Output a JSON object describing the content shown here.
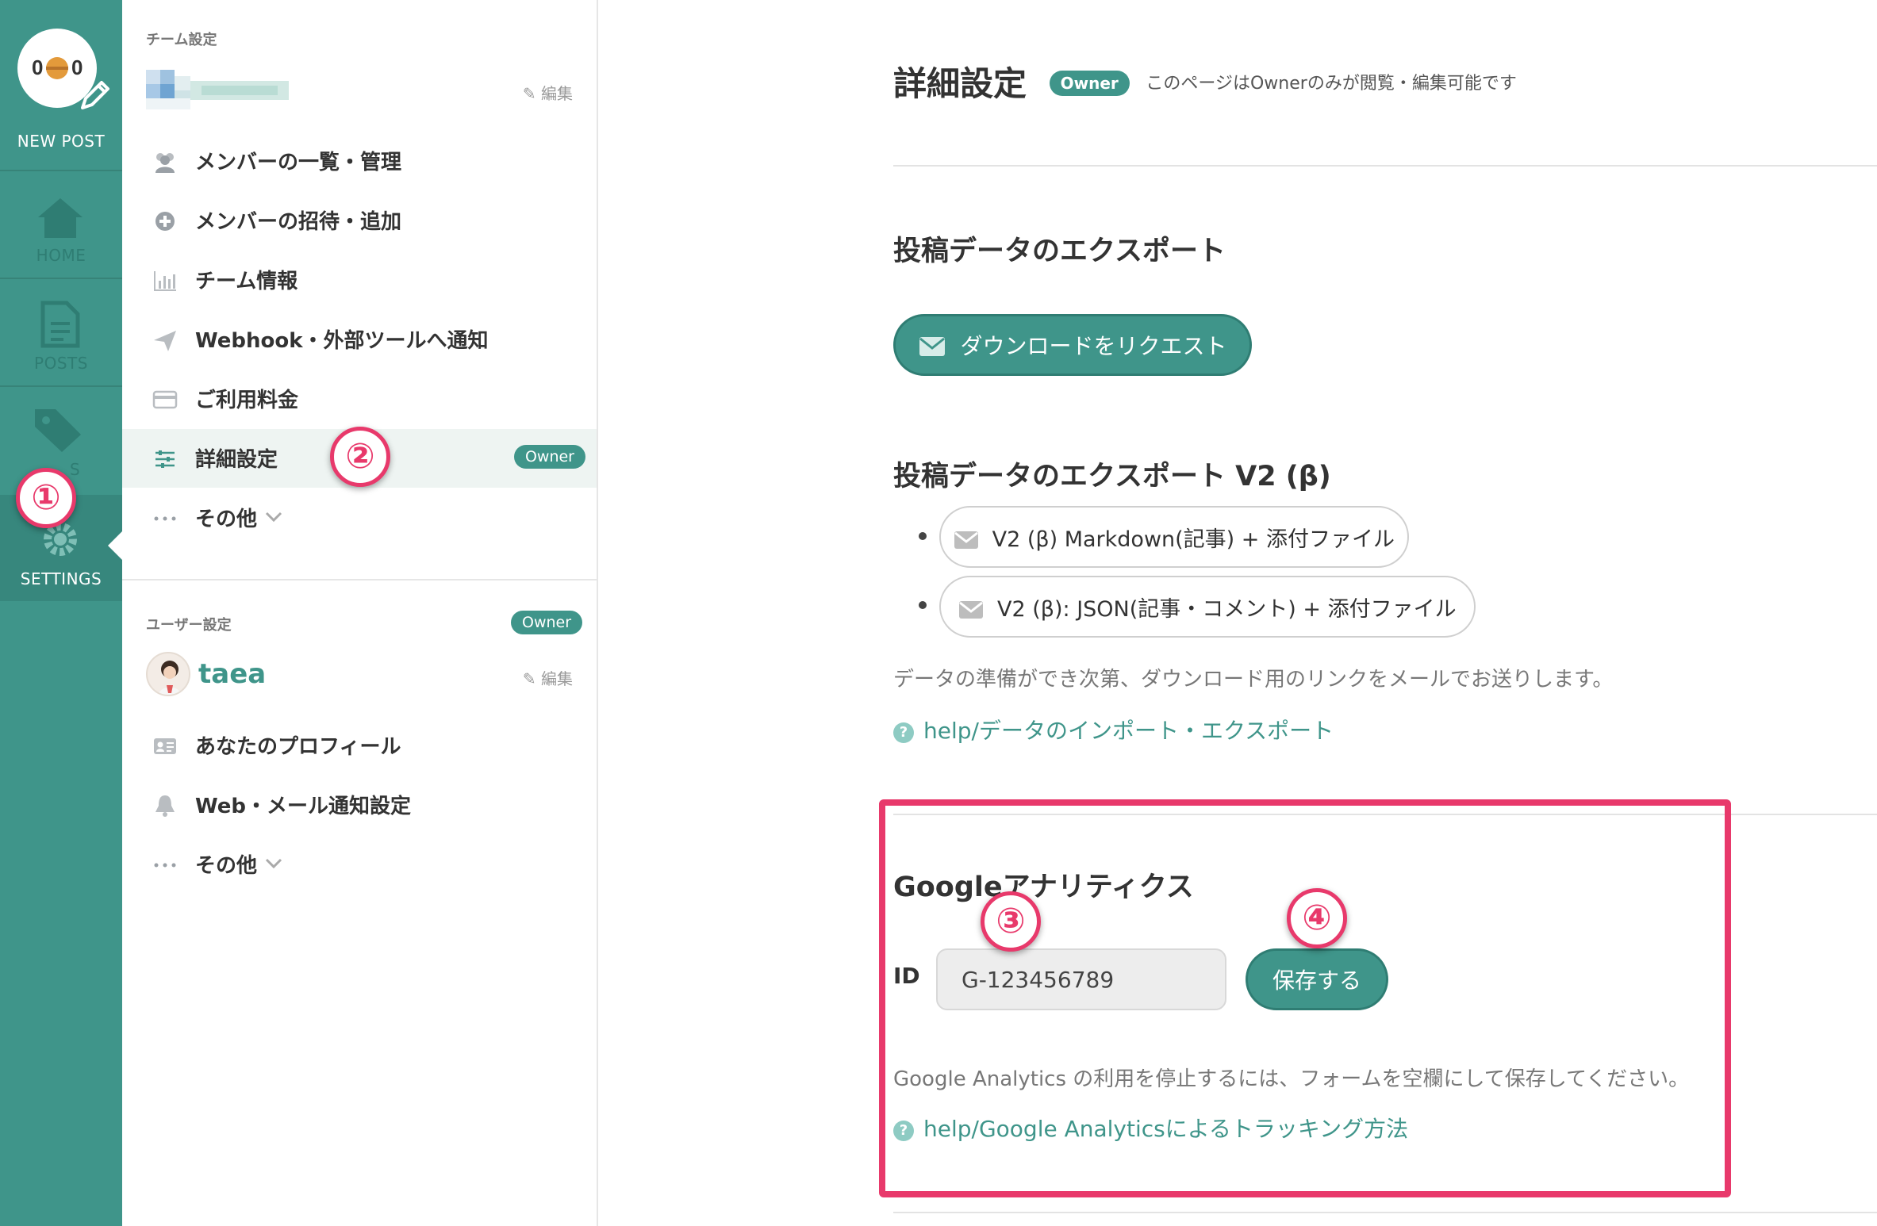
{
  "rail": {
    "new_post": "NEW POST",
    "home": "HOME",
    "posts": "POSTS",
    "tags_partial": "S",
    "settings": "SETTINGS"
  },
  "sidebar": {
    "team_section_title": "チーム設定",
    "edit_label": "編集",
    "team_items": [
      {
        "label": "メンバーの一覧・管理",
        "icon": "members-icon"
      },
      {
        "label": "メンバーの招待・追加",
        "icon": "plus-circle-icon"
      },
      {
        "label": "チーム情報",
        "icon": "bar-chart-icon"
      },
      {
        "label": "Webhook・外部ツールへ通知",
        "icon": "paper-plane-icon"
      },
      {
        "label": "ご利用料金",
        "icon": "credit-card-icon"
      },
      {
        "label": "詳細設定",
        "icon": "sliders-icon",
        "badge": "Owner",
        "active": true
      },
      {
        "label": "その他",
        "icon": "more-dots-icon",
        "dropdown": true
      }
    ],
    "user_section_title": "ユーザー設定",
    "user_owner_badge": "Owner",
    "user_name": "taea",
    "user_items": [
      {
        "label": "あなたのプロフィール",
        "icon": "id-card-icon"
      },
      {
        "label": "Web・メール通知設定",
        "icon": "bell-icon"
      },
      {
        "label": "その他",
        "icon": "more-dots-icon",
        "dropdown": true
      }
    ]
  },
  "main": {
    "title": "詳細設定",
    "owner_badge": "Owner",
    "owner_note": "このページはOwnerのみが閲覧・編集可能です",
    "export_title": "投稿データのエクスポート",
    "request_button": "ダウンロードをリクエスト",
    "export_v2_title": "投稿データのエクスポート V2 (β)",
    "export_v2_options": [
      "V2 (β) Markdown(記事) + 添付ファイル",
      "V2 (β): JSON(記事・コメント) + 添付ファイル"
    ],
    "export_note": "データの準備ができ次第、ダウンロード用のリンクをメールでお送りします。",
    "export_help": "help/データのインポート・エクスポート",
    "ga_title": "Googleアナリティクス",
    "ga_id_label": "ID",
    "ga_id_value": "G-123456789",
    "save_button": "保存する",
    "ga_note": "Google Analytics の利用を停止するには、フォームを空欄にして保存してください。",
    "ga_help": "help/Google Analyticsによるトラッキング方法"
  },
  "annotations": [
    "①",
    "②",
    "③",
    "④"
  ],
  "colors": {
    "accent": "#3f958a",
    "highlight": "#e8396b"
  }
}
